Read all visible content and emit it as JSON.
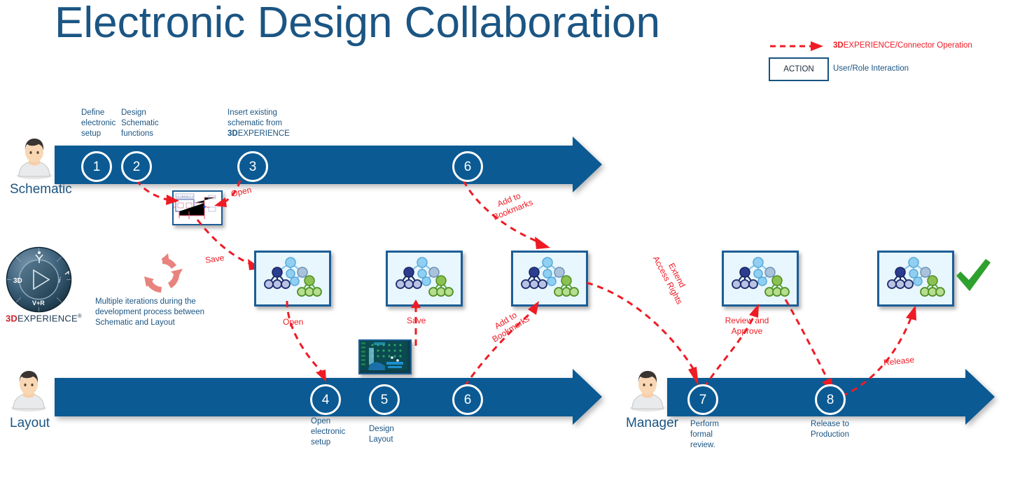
{
  "page": {
    "title": "Electronic Design Collaboration",
    "accent_blue": "#0b5a93",
    "title_blue": "#1b5583",
    "annotation_red": "#ee1b24",
    "green": "#5aa832"
  },
  "legend": {
    "items": [
      {
        "icon": "red-dashed-arrow-icon",
        "label_bold": "3D",
        "label": "EXPERIENCE/Connector Operation"
      },
      {
        "icon": "action-box-icon",
        "box_label": "ACTION",
        "label": "User/Role Interaction"
      }
    ]
  },
  "lanes": [
    {
      "id": "schematic",
      "role_label": "Schematic",
      "avatar": "person-avatar-icon",
      "steps": [
        {
          "number": "1",
          "caption": "Define\nelectronic\nsetup"
        },
        {
          "number": "2",
          "caption": "Design\nSchematic\nfunctions"
        },
        {
          "number": "3",
          "caption_line1": "Insert existing",
          "caption_line2": "schematic from",
          "caption_bold": "3D",
          "caption_line3": "EXPERIENCE"
        },
        {
          "number": "6",
          "caption": ""
        }
      ]
    },
    {
      "id": "layout",
      "role_label": "Layout",
      "avatar": "person-avatar-icon",
      "steps": [
        {
          "number": "4",
          "caption": "Open\nelectronic\nsetup"
        },
        {
          "number": "5",
          "caption": "Design\nLayout"
        },
        {
          "number": "6",
          "caption": ""
        }
      ]
    },
    {
      "id": "manager",
      "role_label": "Manager",
      "avatar": "person-avatar-icon",
      "steps": [
        {
          "number": "7",
          "caption": "Perform\nformal\nreview."
        },
        {
          "number": "8",
          "caption": "Release to\nProduction"
        }
      ]
    }
  ],
  "annotations": {
    "open_schematic": "Open",
    "save_schematic": "Save",
    "add_to_bookmarks_top_l1": "Add to",
    "add_to_bookmarks_top_l2": "Bookmarks",
    "open_layout": "Open",
    "save_layout": "Save",
    "add_to_bookmarks_bottom_l1": "Add to",
    "add_to_bookmarks_bottom_l2": "Bookmarks",
    "extend_access_l1": "Extend",
    "extend_access_l2": "Access Rights",
    "review_and_approve_l1": "Review and",
    "review_and_approve_l2": "Approve",
    "release": "Release"
  },
  "compass": {
    "brand_bold": "3D",
    "brand": "EXPERIENCE",
    "trademark": "®",
    "quadrants": {
      "top": "Y",
      "left": "3D",
      "right": "i",
      "bottom": "V+R"
    }
  },
  "iteration_note": {
    "icon": "circular-arrows-icon",
    "text": "Multiple iterations during the development process between Schematic and Layout"
  },
  "thumbnails": {
    "schematic_diagram": "schematic-circuit-thumbnail",
    "pcb_layout": "pcb-layout-thumbnail",
    "product_tree": "product-structure-tree-thumbnail"
  },
  "status": {
    "approved_icon": "green-check-icon"
  }
}
